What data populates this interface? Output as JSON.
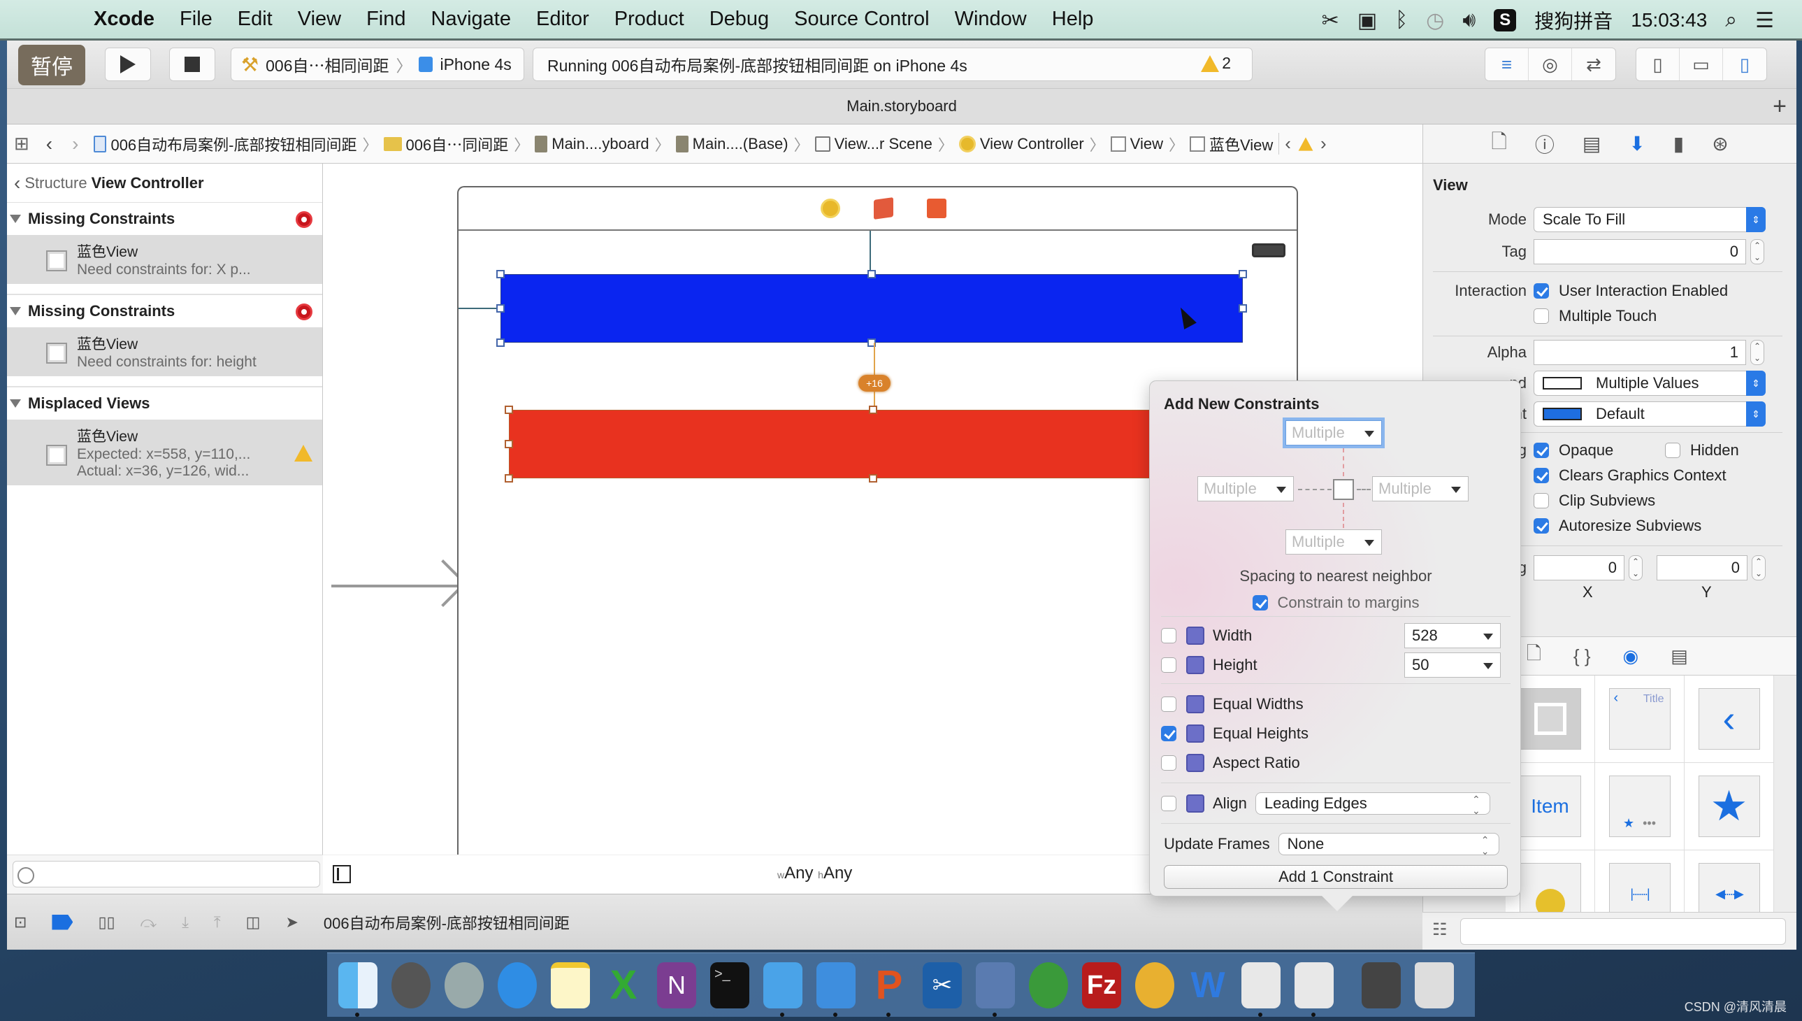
{
  "menubar": {
    "app_name": "Xcode",
    "items": [
      "File",
      "Edit",
      "View",
      "Find",
      "Navigate",
      "Editor",
      "Product",
      "Debug",
      "Source Control",
      "Window",
      "Help"
    ],
    "input_method": "搜狗拼音",
    "clock": "15:03:43"
  },
  "toolbar": {
    "pause_label": "暂停",
    "scheme": "006自⋯相同间距",
    "device": "iPhone 4s",
    "activity": "Running 006自动布局案例-底部按钮相同间距 on iPhone 4s",
    "warning_count": "2"
  },
  "tab": {
    "title": "Main.storyboard"
  },
  "jumpbar": {
    "crumbs": [
      "006自动布局案例-底部按钮相同间距",
      "006自⋯同间距",
      "Main....yboard",
      "Main....(Base)",
      "View...r Scene",
      "View Controller",
      "View",
      "蓝色View"
    ]
  },
  "navigator": {
    "back_label": "Structure",
    "title": "View Controller",
    "groups": [
      {
        "title": "Missing Constraints",
        "severity": "error",
        "items": [
          {
            "name": "蓝色View",
            "lines": [
              "Need constraints for: X p..."
            ]
          }
        ]
      },
      {
        "title": "Missing Constraints",
        "severity": "error",
        "items": [
          {
            "name": "蓝色View",
            "lines": [
              "Need constraints for: height"
            ]
          }
        ]
      },
      {
        "title": "Misplaced Views",
        "severity": "warning",
        "items": [
          {
            "name": "蓝色View",
            "lines": [
              "Expected: x=558, y=110,...",
              "Actual: x=36, y=126, wid..."
            ]
          }
        ]
      }
    ]
  },
  "canvas": {
    "spacing_badge": "+16",
    "size_class_w": "w",
    "size_class_w_value": "Any",
    "size_class_h": "h",
    "size_class_h_value": "Any",
    "colors": {
      "blue_view": "#0a25f0",
      "red_view": "#e8321f"
    }
  },
  "popover": {
    "title": "Add New Constraints",
    "spacing_top": "Multiple",
    "spacing_left": "Multiple",
    "spacing_right": "Multiple",
    "spacing_bottom": "Multiple",
    "spacing_caption": "Spacing to nearest neighbor",
    "constrain_to_margins": {
      "label": "Constrain to margins",
      "checked": true
    },
    "width": {
      "label": "Width",
      "value": "528",
      "checked": false
    },
    "height": {
      "label": "Height",
      "value": "50",
      "checked": false
    },
    "equal_widths": {
      "label": "Equal Widths",
      "checked": false
    },
    "equal_heights": {
      "label": "Equal Heights",
      "checked": true
    },
    "aspect_ratio": {
      "label": "Aspect Ratio",
      "checked": false
    },
    "align": {
      "label": "Align",
      "value": "Leading Edges",
      "checked": false
    },
    "update_frames": {
      "label": "Update Frames",
      "value": "None"
    },
    "add_button": "Add 1 Constraint"
  },
  "inspector": {
    "section": "View",
    "mode": {
      "label": "Mode",
      "value": "Scale To Fill"
    },
    "tag": {
      "label": "Tag",
      "value": "0"
    },
    "interaction": {
      "label": "Interaction",
      "user_interaction": "User Interaction Enabled",
      "user_interaction_checked": true,
      "multiple_touch": "Multiple Touch",
      "multiple_touch_checked": false
    },
    "alpha": {
      "label": "Alpha",
      "value": "1"
    },
    "background": {
      "label_partial": "nd",
      "value": "Multiple Values"
    },
    "tint": {
      "label_partial": "int",
      "value": "Default"
    },
    "drawing": {
      "label_partial": "ng",
      "opaque": "Opaque",
      "opaque_checked": true,
      "hidden": "Hidden",
      "hidden_checked": false,
      "clears": "Clears Graphics Context",
      "clears_checked": true,
      "clip": "Clip Subviews",
      "clip_checked": false,
      "autoresize": "Autoresize Subviews",
      "autoresize_checked": true
    },
    "stretching": {
      "label_partial": "ng",
      "x": "0",
      "y": "0",
      "x_label": "X",
      "y_label": "Y"
    }
  },
  "library": {
    "items": [
      "view",
      "navigation-bar",
      "back-button",
      "bar-button-item",
      "tab-bar",
      "tab-bar-item",
      "search-bar",
      "fixed-space",
      "flexible-space"
    ],
    "nav_title": "Title",
    "item_label": "Item"
  },
  "debugbar": {
    "process": "006自动布局案例-底部按钮相同间距"
  },
  "dock": {
    "watermark": "CSDN @清风清晨"
  }
}
